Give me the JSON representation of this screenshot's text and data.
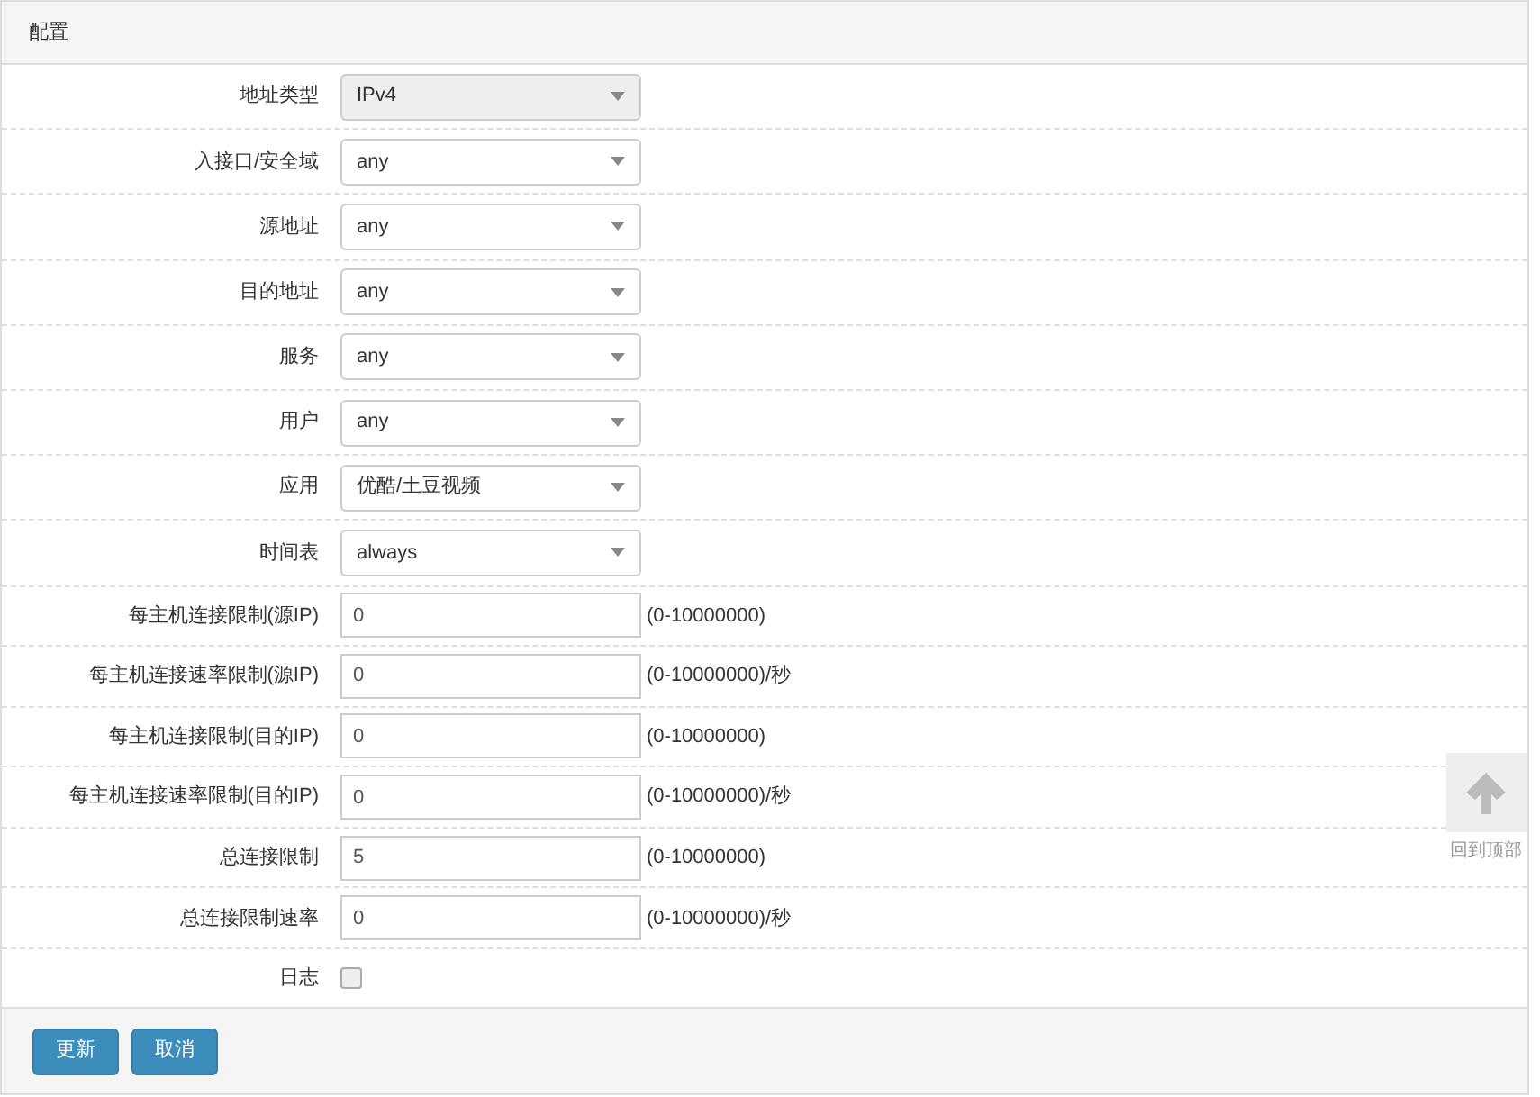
{
  "panel": {
    "title": "配置"
  },
  "rows": [
    {
      "kind": "select",
      "label": "地址类型",
      "value": "IPv4",
      "disabled": true
    },
    {
      "kind": "select",
      "label": "入接口/安全域",
      "value": "any",
      "disabled": false
    },
    {
      "kind": "select",
      "label": "源地址",
      "value": "any",
      "disabled": false
    },
    {
      "kind": "select",
      "label": "目的地址",
      "value": "any",
      "disabled": false
    },
    {
      "kind": "select",
      "label": "服务",
      "value": "any",
      "disabled": false
    },
    {
      "kind": "select",
      "label": "用户",
      "value": "any",
      "disabled": false
    },
    {
      "kind": "select",
      "label": "应用",
      "value": "优酷/土豆视频",
      "disabled": false
    },
    {
      "kind": "select",
      "label": "时间表",
      "value": "always",
      "disabled": false
    },
    {
      "kind": "input",
      "label": "每主机连接限制(源IP)",
      "value": "0",
      "hint": "(0-10000000)"
    },
    {
      "kind": "input",
      "label": "每主机连接速率限制(源IP)",
      "value": "0",
      "hint": "(0-10000000)/秒"
    },
    {
      "kind": "input",
      "label": "每主机连接限制(目的IP)",
      "value": "0",
      "hint": "(0-10000000)"
    },
    {
      "kind": "input",
      "label": "每主机连接速率限制(目的IP)",
      "value": "0",
      "hint": "(0-10000000)/秒"
    },
    {
      "kind": "input",
      "label": "总连接限制",
      "value": "5",
      "hint": "(0-10000000)"
    },
    {
      "kind": "input",
      "label": "总连接限制速率",
      "value": "0",
      "hint": "(0-10000000)/秒"
    },
    {
      "kind": "checkbox",
      "label": "日志",
      "checked": false
    }
  ],
  "buttons": [
    "更新",
    "取消"
  ],
  "back_to_top": {
    "label": "回到顶部"
  }
}
